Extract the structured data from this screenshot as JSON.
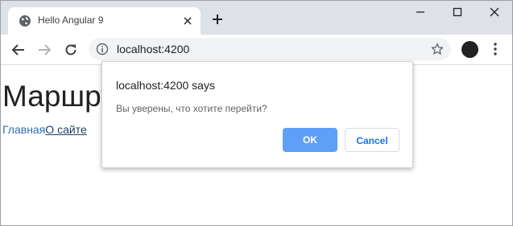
{
  "tab": {
    "title": "Hello Angular 9"
  },
  "address_bar": {
    "url": "localhost:4200"
  },
  "profile": {
    "avatar_text": ""
  },
  "page": {
    "heading": "Маршрут",
    "nav_links": [
      {
        "label": "Главная"
      },
      {
        "label": "О сайте"
      }
    ]
  },
  "dialog": {
    "title": "localhost:4200 says",
    "message": "Вы уверены, что хотите перейти?",
    "ok_label": "OK",
    "cancel_label": "Cancel"
  },
  "icons": {
    "favicon": "globe-icon",
    "tab_close": "close-icon",
    "new_tab": "plus-icon",
    "minimize": "minimize-icon",
    "maximize": "maximize-icon",
    "close": "close-icon",
    "back": "back-arrow-icon",
    "forward": "forward-arrow-icon",
    "reload": "reload-icon",
    "site_info": "info-icon",
    "bookmark": "star-icon",
    "menu": "kebab-menu-icon"
  },
  "colors": {
    "tabstrip": "#dee1e6",
    "link": "#2f6db5",
    "ok_button": "#5e9ff8",
    "cancel_text": "#1a73e8"
  }
}
